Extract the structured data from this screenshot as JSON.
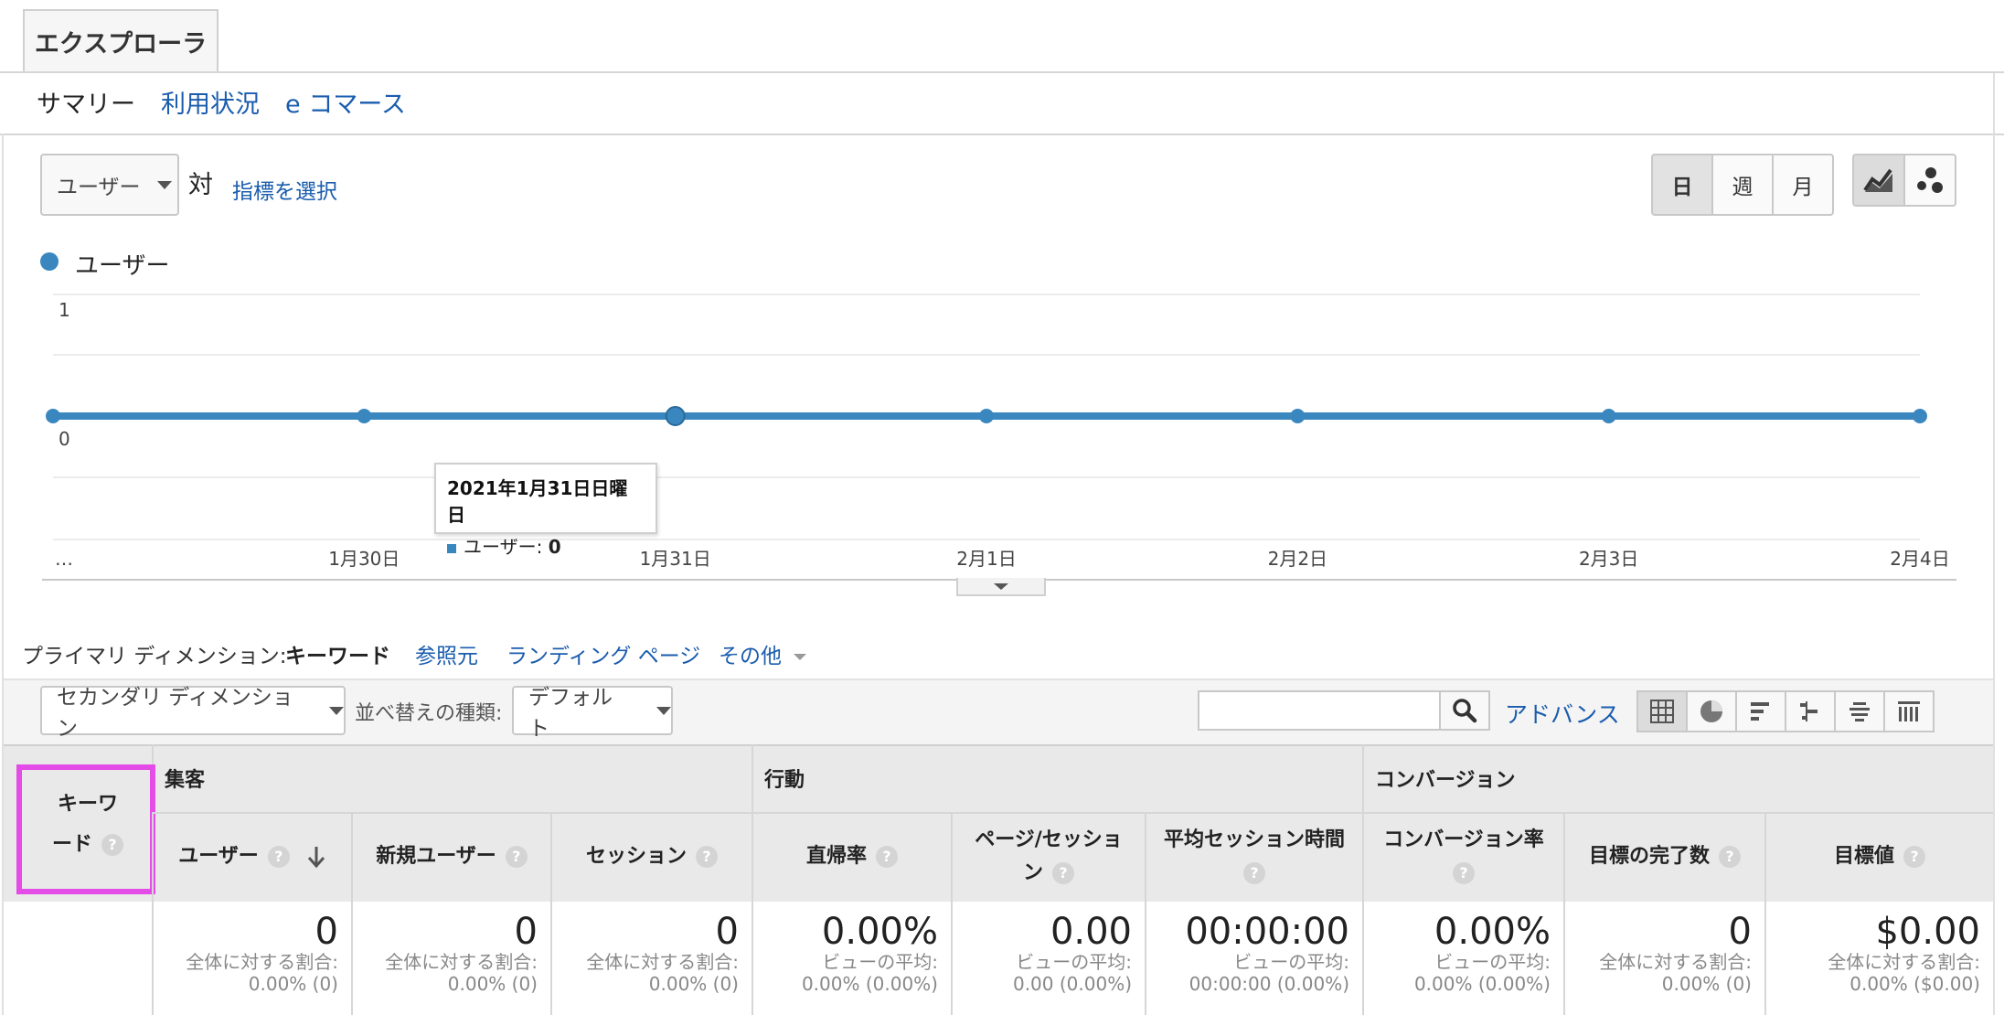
{
  "explorer_tab": "エクスプローラ",
  "subtabs": [
    "サマリー",
    "利用状況",
    "e コマース"
  ],
  "metric_select": {
    "value": "ユーザー",
    "vs": "対",
    "select_metric": "指標を選択"
  },
  "period_buttons": [
    "日",
    "週",
    "月"
  ],
  "legend": "ユーザー",
  "colors": {
    "series": "#3a87c0",
    "highlight": "#e34ce6",
    "link": "#1a5cad"
  },
  "chart_data": {
    "type": "line",
    "x": [
      "…",
      "1月30日",
      "1月31日",
      "2月1日",
      "2月2日",
      "2月3日",
      "2月4日"
    ],
    "series": [
      {
        "name": "ユーザー",
        "values": [
          0,
          0,
          0,
          0,
          0,
          0,
          0
        ]
      }
    ],
    "ylim": [
      0,
      1
    ],
    "yticks": [
      "1",
      "0"
    ],
    "grid": true,
    "tooltip": {
      "title": "2021年1月31日日曜日",
      "label": "ユーザー:",
      "value": "0"
    }
  },
  "primary_dimension": {
    "label": "プライマリ ディメンション:",
    "active": "キーワード",
    "options": [
      "参照元",
      "ランディング ページ",
      "その他"
    ]
  },
  "secondary_dimension": "セカンダリ ディメンション",
  "sort": {
    "label": "並べ替えの種類:",
    "value": "デフォルト"
  },
  "advanced": "アドバンス",
  "table": {
    "key_col": [
      "キーワ",
      "ード"
    ],
    "groups": [
      "集客",
      "行動",
      "コンバージョン"
    ],
    "help": "?",
    "headers": [
      [
        "ユーザー"
      ],
      [
        "新規ユーザー"
      ],
      [
        "セッション"
      ],
      [
        "直帰率"
      ],
      [
        "ページ/セッショ",
        "ン"
      ],
      [
        "平均セッション時間",
        ""
      ],
      [
        "コンバージョン率",
        ""
      ],
      [
        "目標の完了数"
      ],
      [
        "目標値"
      ]
    ],
    "totals": [
      {
        "big": "0",
        "s1": "全体に対する割合:",
        "s2": "0.00% (0)"
      },
      {
        "big": "0",
        "s1": "全体に対する割合:",
        "s2": "0.00% (0)"
      },
      {
        "big": "0",
        "s1": "全体に対する割合:",
        "s2": "0.00% (0)"
      },
      {
        "big": "0.00%",
        "s1": "ビューの平均:",
        "s2": "0.00% (0.00%)"
      },
      {
        "big": "0.00",
        "s1": "ビューの平均:",
        "s2": "0.00 (0.00%)"
      },
      {
        "big": "00:00:00",
        "s1": "ビューの平均:",
        "s2": "00:00:00 (0.00%)"
      },
      {
        "big": "0.00%",
        "s1": "ビューの平均:",
        "s2": "0.00% (0.00%)"
      },
      {
        "big": "0",
        "s1": "全体に対する割合:",
        "s2": "0.00% (0)"
      },
      {
        "big": "$0.00",
        "s1": "全体に対する割合:",
        "s2": "0.00% ($0.00)"
      }
    ]
  }
}
